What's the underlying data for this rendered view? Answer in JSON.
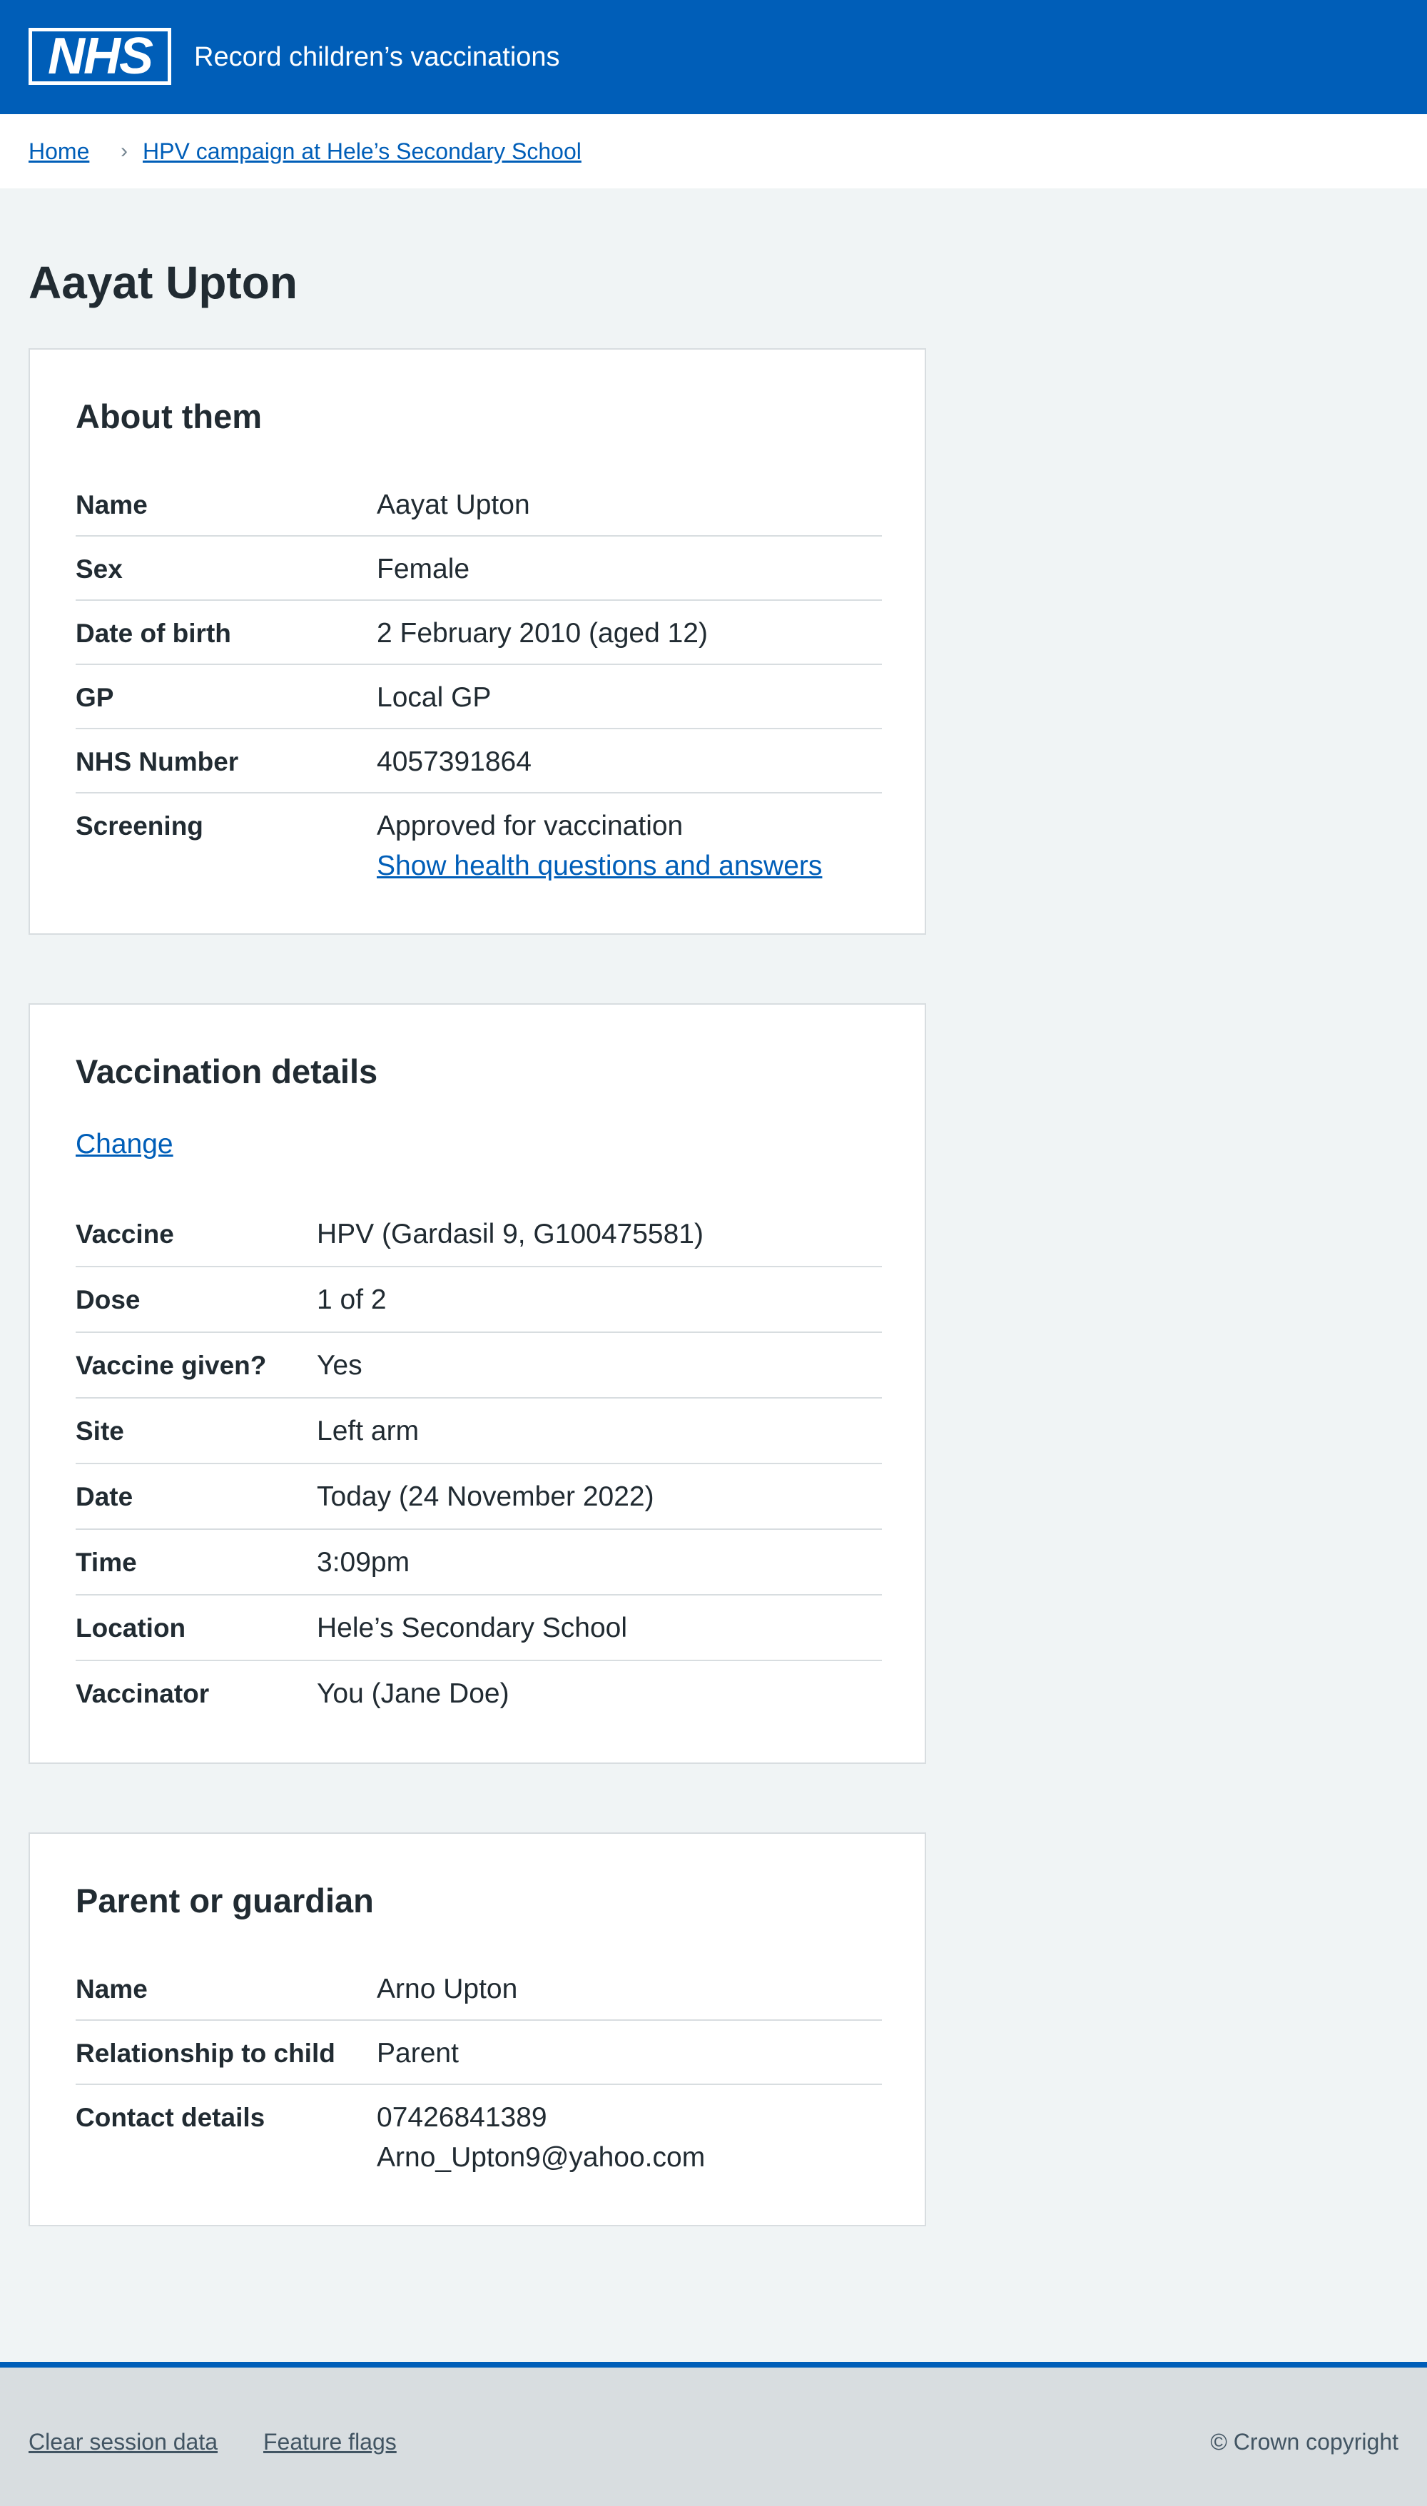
{
  "header": {
    "logo_text": "NHS",
    "service_name": "Record children’s vaccinations"
  },
  "breadcrumb": {
    "home": "Home",
    "separator": "›",
    "campaign": "HPV campaign at Hele’s Secondary School"
  },
  "page_title": "Aayat Upton",
  "about": {
    "title": "About them",
    "rows": [
      {
        "key": "Name",
        "value": "Aayat Upton"
      },
      {
        "key": "Sex",
        "value": "Female"
      },
      {
        "key": "Date of birth",
        "value": "2 February 2010 (aged 12)"
      },
      {
        "key": "GP",
        "value": "Local GP"
      },
      {
        "key": "NHS Number",
        "value": "4057391864"
      },
      {
        "key": "Screening",
        "value": "Approved for vaccination",
        "link": "Show health questions and answers"
      }
    ]
  },
  "vaccination": {
    "title": "Vaccination details",
    "change_label": "Change",
    "rows": [
      {
        "key": "Vaccine",
        "value": "HPV (Gardasil 9, G100475581)"
      },
      {
        "key": "Dose",
        "value": "1 of 2"
      },
      {
        "key": "Vaccine given?",
        "value": "Yes"
      },
      {
        "key": "Site",
        "value": "Left arm"
      },
      {
        "key": "Date",
        "value": "Today (24 November 2022)"
      },
      {
        "key": "Time",
        "value": "3:09pm"
      },
      {
        "key": "Location",
        "value": "Hele’s Secondary School"
      },
      {
        "key": "Vaccinator",
        "value": "You (Jane Doe)"
      }
    ]
  },
  "parent": {
    "title": "Parent or guardian",
    "rows": [
      {
        "key": "Name",
        "value": "Arno Upton"
      },
      {
        "key": "Relationship to child",
        "value": "Parent"
      },
      {
        "key": "Contact details",
        "phone": "07426841389",
        "email": "Arno_Upton9@yahoo.com"
      }
    ]
  },
  "footer": {
    "clear_session": "Clear session data",
    "feature_flags": "Feature flags",
    "copyright": "© Crown copyright"
  },
  "colors": {
    "brand_blue": "#005eb8",
    "page_background": "#f0f4f5",
    "text": "#212b32",
    "border": "#d8dde0"
  }
}
